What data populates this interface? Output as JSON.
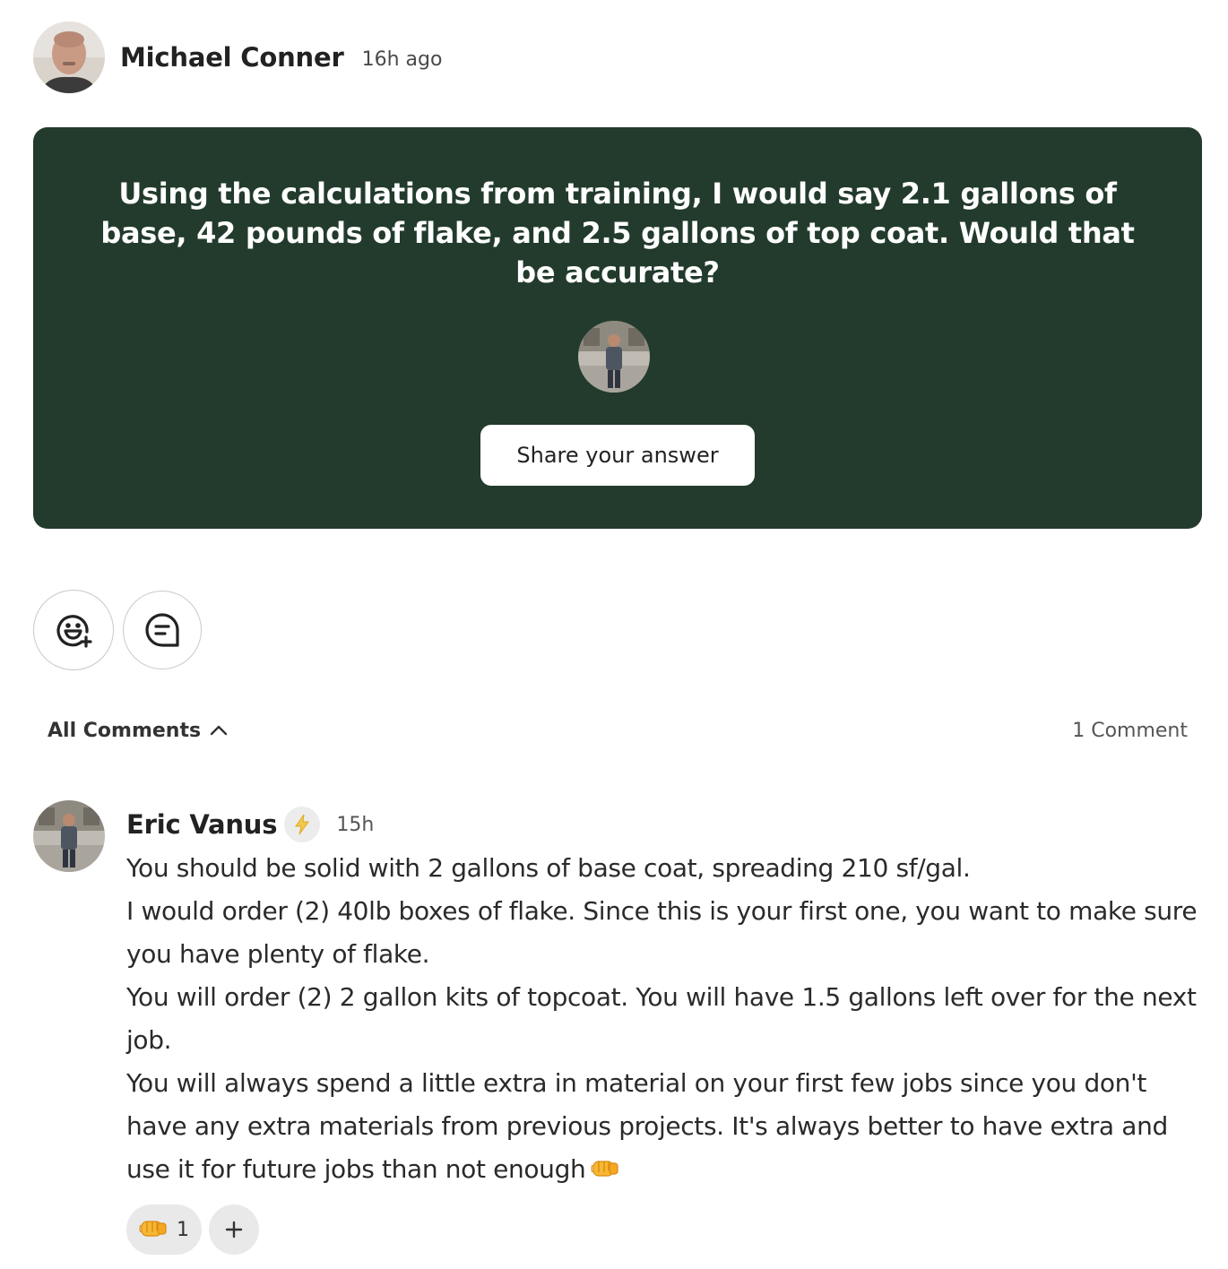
{
  "post": {
    "author": "Michael Conner",
    "time": "16h ago",
    "question": "Using the calculations from training, I would say 2.1 gallons of base, 42 pounds of flake, and 2.5 gallons of top coat. Would that be accurate?",
    "share_label": "Share your answer",
    "card_color": "#223b2c"
  },
  "actions": {
    "react_icon": "emoji-add-icon",
    "comment_icon": "comment-bubble-icon"
  },
  "comments_bar": {
    "all_label": "All Comments",
    "count_label": "1 Comment"
  },
  "comment": {
    "author": "Eric Vanus",
    "badge_icon": "lightning-bolt-icon",
    "time": "15h",
    "lines": [
      "You should be solid with 2 gallons of base coat, spreading 210 sf/gal.",
      "I would order (2) 40lb boxes of flake. Since this is your first one, you want to make sure you have plenty of flake.",
      "You will order (2) 2 gallon kits of topcoat. You will have 1.5 gallons left over for the next job.",
      "You will always spend a little extra in material on your first few jobs since you don't have any extra materials from previous projects. It's always better to have extra and use it for future jobs than not enough"
    ],
    "trailing_emoji": "fist-bump-icon",
    "reactions": [
      {
        "emoji": "fist-bump-icon",
        "count": "1"
      }
    ],
    "add_reaction_icon": "plus-icon"
  }
}
